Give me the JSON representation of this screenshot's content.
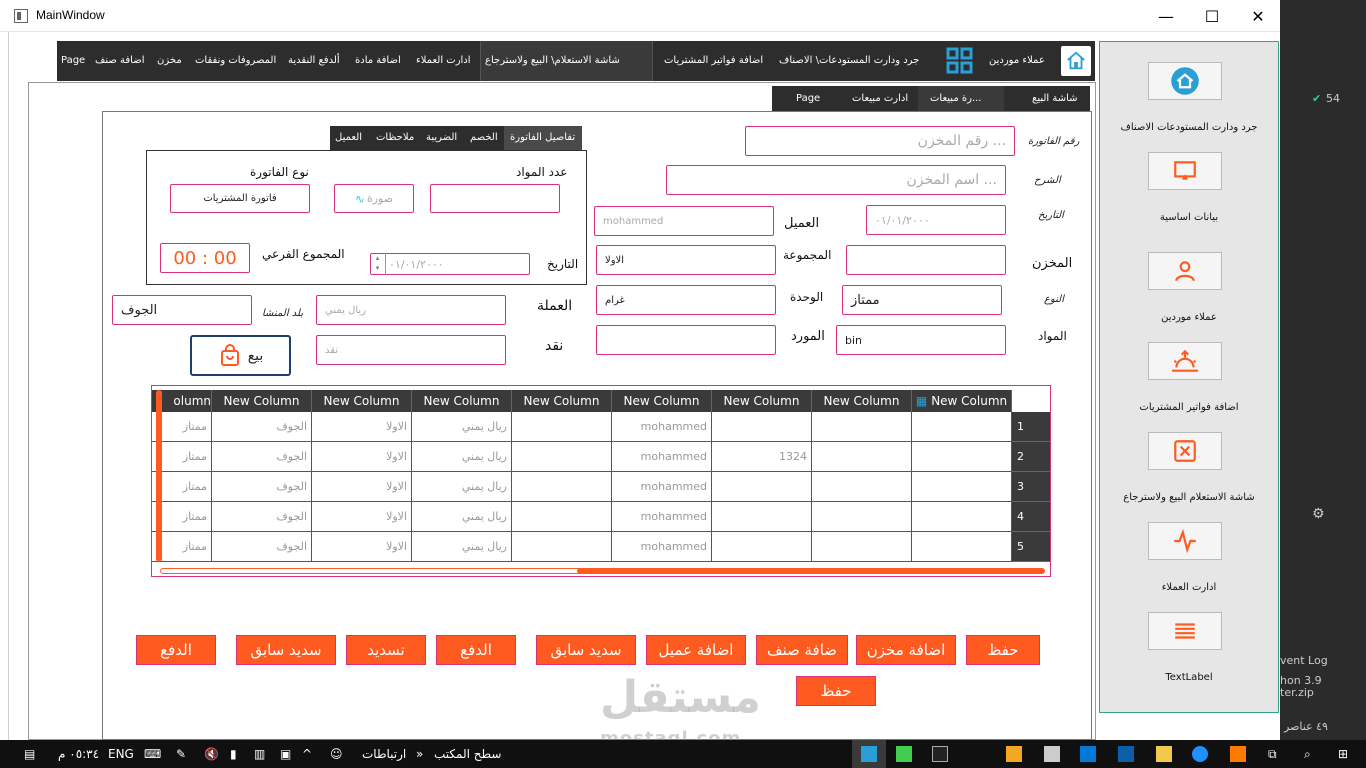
{
  "window": {
    "title": "MainWindow",
    "minimize": "—",
    "maximize": "☐",
    "close": "✕"
  },
  "topnav": {
    "items": [
      "عملاء موردين",
      "جرد ودارت المستودعات\\ الاصناف",
      "اضافة فواتير المشتريات",
      "شاشة الاستعلام\\ البيع ولاسترجاع",
      "ادارت العملاء",
      "اضافة مادة",
      "ألدفع النقدية",
      "المصروفات ونفقات",
      "مخزن",
      "اضافة صنف",
      "Page"
    ]
  },
  "sidebar": {
    "items": [
      {
        "label": "جرد ودارت المستودعات   الاصناف",
        "icon": "home-icon"
      },
      {
        "label": "بيانات اساسية",
        "icon": "monitor-icon"
      },
      {
        "label": "عملاء موردين",
        "icon": "user-icon"
      },
      {
        "label": "اضافة فواتير المشتريات",
        "icon": "sunrise-icon"
      },
      {
        "label": "شاشة الاستعلام  البيع ولاسترجاع",
        "icon": "close-box-icon"
      },
      {
        "label": "ادارت العملاء",
        "icon": "activity-icon"
      },
      {
        "label": "TextLabel",
        "icon": "menu-icon"
      }
    ]
  },
  "subtabs": [
    "شاشة البيع",
    "رة مبيعات...",
    "ادارت مبيعات",
    "Page"
  ],
  "invtabs": [
    "تفاصيل الفاتورة",
    "الخصم",
    "الضريبة",
    "ملاحظات",
    "العميل"
  ],
  "form": {
    "invoice_no_label": "رقم الفاتورة",
    "invoice_no_ph": "رقم المخزن ...",
    "desc_label": "الشرح",
    "desc_ph": "اسم المخزن ...",
    "date_label": "التاريخ",
    "date_value": "٠١/٠١/٢٠٠٠",
    "customer_label": "العميل",
    "customer_value": "mohammed",
    "store_label": "المخزن",
    "group_label": "المجموعة",
    "group_value": "الاولا",
    "type_label": "النوع",
    "type_value": "ممتاز",
    "unit_label": "الوحدة",
    "unit_value": "غرام",
    "materials_label": "المواد",
    "materials_value": "bin",
    "supplier_label": "المورد",
    "currency_label": "العملة",
    "currency_value": "ريال يمني",
    "origin_label": "بلد المنشا",
    "origin_value": "الجوف",
    "cash_label": "نقد",
    "cash_value": "نقد",
    "sell_label": "بيع"
  },
  "details": {
    "count_label": "عدد المواد",
    "invtype_label": "نوع الفاتورة",
    "invtype_value": "فاتورة المشتريات",
    "image_value": "صورة",
    "subtotal_label": "المجموع الفرعي",
    "time_value": "00 : 00",
    "date_label": "التاريخ",
    "date_value": "٠١/٠١/٢٠٠٠"
  },
  "table": {
    "headers": [
      "New Column",
      "New Column",
      "New Column",
      "New Column",
      "New Column",
      "New Column",
      "New Column",
      "New Column",
      "olumn"
    ],
    "rows": [
      [
        "",
        "",
        "",
        "mohammed",
        "",
        "ريال يمني",
        "الاولا",
        "الجوف",
        "ممتاز"
      ],
      [
        "",
        "",
        "1324",
        "mohammed",
        "",
        "ريال يمني",
        "الاولا",
        "الجوف",
        "ممتاز"
      ],
      [
        "",
        "",
        "",
        "mohammed",
        "",
        "ريال يمني",
        "الاولا",
        "الجوف",
        "ممتاز"
      ],
      [
        "",
        "",
        "",
        "mohammed",
        "",
        "ريال يمني",
        "الاولا",
        "الجوف",
        "ممتاز"
      ],
      [
        "",
        "",
        "",
        "mohammed",
        "",
        "ريال يمني",
        "الاولا",
        "الجوف",
        "ممتاز"
      ]
    ],
    "row_numbers": [
      "1",
      "2",
      "3",
      "4",
      "5"
    ]
  },
  "buttons": [
    "حفظ",
    "اضافة مخزن",
    "ضافة صنف",
    "اضافة عميل",
    "سديد سابق",
    "الدفع",
    "تسديد",
    "سديد سابق",
    "الدفع",
    "حفظ"
  ],
  "bg_window": {
    "count": "54",
    "event_log": "vent Log",
    "python": "hon 3.9",
    "file": "ter.zip"
  },
  "taskbar": {
    "time": "٠٥:٣٤ م",
    "lang": "ENG",
    "links": "ارتباطات",
    "desktop": "سطح المكتب",
    "items_count": "٤٩ عناصر"
  },
  "watermark": {
    "ar": "مستقل",
    "en": "mostaql.com"
  },
  "colors": {
    "accent": "#ff5a1f",
    "border": "#d8317a",
    "dark": "#2d2d2d",
    "icon_blue": "#2a9fd6"
  }
}
